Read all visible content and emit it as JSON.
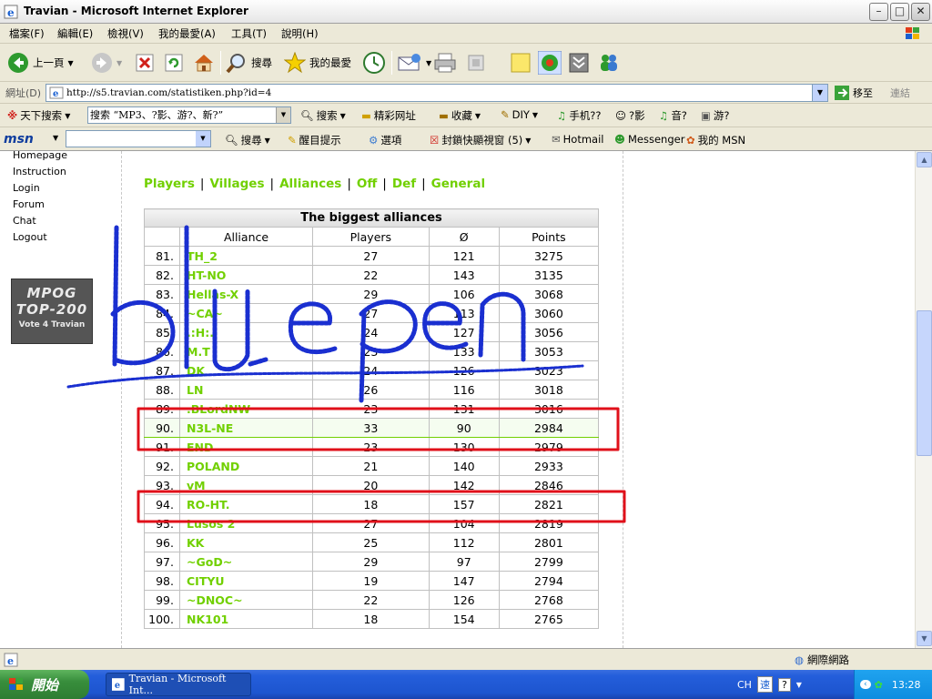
{
  "window": {
    "title": "Travian - Microsoft Internet Explorer",
    "min": "–",
    "max": "□",
    "close": "✕"
  },
  "menu": {
    "items": [
      "檔案(F)",
      "編輯(E)",
      "檢視(V)",
      "我的最愛(A)",
      "工具(T)",
      "說明(H)"
    ]
  },
  "toolbar": {
    "back": "上一頁",
    "search": "搜尋",
    "favorites": "我的最愛"
  },
  "address": {
    "label": "網址(D)",
    "url": "http://s5.travian.com/statistiken.php?id=4",
    "go": "移至",
    "links": "連結"
  },
  "searchbar": {
    "brand": "天下搜索",
    "query": "搜索 “MP3、?影、游?、新?”",
    "search": "搜索",
    "sites": "精彩网址",
    "collect": "收藏",
    "diy": "DIY",
    "phone": "手机??",
    "movie": "?影",
    "music": "音?",
    "game": "游?"
  },
  "msnbar": {
    "logo": "msn",
    "search": "搜尋",
    "highlight": "醒目提示",
    "options": "選項",
    "popup": "封鎖快顯視窗 (5)",
    "hotmail": "Hotmail",
    "messenger": "Messenger",
    "mymsn": "我的 MSN"
  },
  "nav": {
    "homepage": "Homepage",
    "instruction": "Instruction",
    "login": "Login",
    "forum": "Forum",
    "chat": "Chat",
    "logout": "Logout"
  },
  "banner": {
    "l1": "MPOG",
    "l2": "TOP-200",
    "l3": "Vote 4 Travian"
  },
  "tabs": [
    "Players",
    "Villages",
    "Alliances",
    "Off",
    "Def",
    "General"
  ],
  "table": {
    "caption": "The biggest alliances",
    "headers": [
      "",
      "Alliance",
      "Players",
      "Ø",
      "Points"
    ],
    "rows": [
      {
        "rank": "81.",
        "name": "TH_2",
        "players": "27",
        "avg": "121",
        "points": "3275"
      },
      {
        "rank": "82.",
        "name": "HT-NO",
        "players": "22",
        "avg": "143",
        "points": "3135"
      },
      {
        "rank": "83.",
        "name": "Hellas-X",
        "players": "29",
        "avg": "106",
        "points": "3068"
      },
      {
        "rank": "84.",
        "name": "~CA~",
        "players": "27",
        "avg": "113",
        "points": "3060"
      },
      {
        "rank": "85.",
        "name": ".:H:.",
        "players": "24",
        "avg": "127",
        "points": "3056"
      },
      {
        "rank": "86.",
        "name": "M.T",
        "players": "23",
        "avg": "133",
        "points": "3053"
      },
      {
        "rank": "87.",
        "name": "DK",
        "players": "24",
        "avg": "126",
        "points": "3023"
      },
      {
        "rank": "88.",
        "name": "LN",
        "players": "26",
        "avg": "116",
        "points": "3018"
      },
      {
        "rank": "89.",
        "name": ".BLordNW",
        "players": "23",
        "avg": "131",
        "points": "3016"
      },
      {
        "rank": "90.",
        "name": "N3L-NE",
        "players": "33",
        "avg": "90",
        "points": "2984"
      },
      {
        "rank": "91.",
        "name": "END",
        "players": "23",
        "avg": "130",
        "points": "2979"
      },
      {
        "rank": "92.",
        "name": "POLAND",
        "players": "21",
        "avg": "140",
        "points": "2933"
      },
      {
        "rank": "93.",
        "name": "vM",
        "players": "20",
        "avg": "142",
        "points": "2846"
      },
      {
        "rank": "94.",
        "name": "RO-HT.",
        "players": "18",
        "avg": "157",
        "points": "2821"
      },
      {
        "rank": "95.",
        "name": "Lusos 2",
        "players": "27",
        "avg": "104",
        "points": "2819"
      },
      {
        "rank": "96.",
        "name": "KK",
        "players": "25",
        "avg": "112",
        "points": "2801"
      },
      {
        "rank": "97.",
        "name": "~GoD~",
        "players": "29",
        "avg": "97",
        "points": "2799"
      },
      {
        "rank": "98.",
        "name": "CITYU",
        "players": "19",
        "avg": "147",
        "points": "2794"
      },
      {
        "rank": "99.",
        "name": "~DNOC~",
        "players": "22",
        "avg": "126",
        "points": "2768"
      },
      {
        "rank": "100.",
        "name": "NK101",
        "players": "18",
        "avg": "154",
        "points": "2765"
      }
    ],
    "highlighted_rank": "90."
  },
  "annotation": {
    "text": "blue pen",
    "color": "#1a2fd0",
    "box_color": "#e0101a"
  },
  "status": {
    "zone": "網際網路"
  },
  "taskbar": {
    "start": "開始",
    "task": "Travian - Microsoft Int...",
    "lang": "CH",
    "ime": "速",
    "help": "?",
    "clock": "13:28"
  },
  "colors": {
    "link_green": "#71d000",
    "xp_blue": "#245edb"
  }
}
